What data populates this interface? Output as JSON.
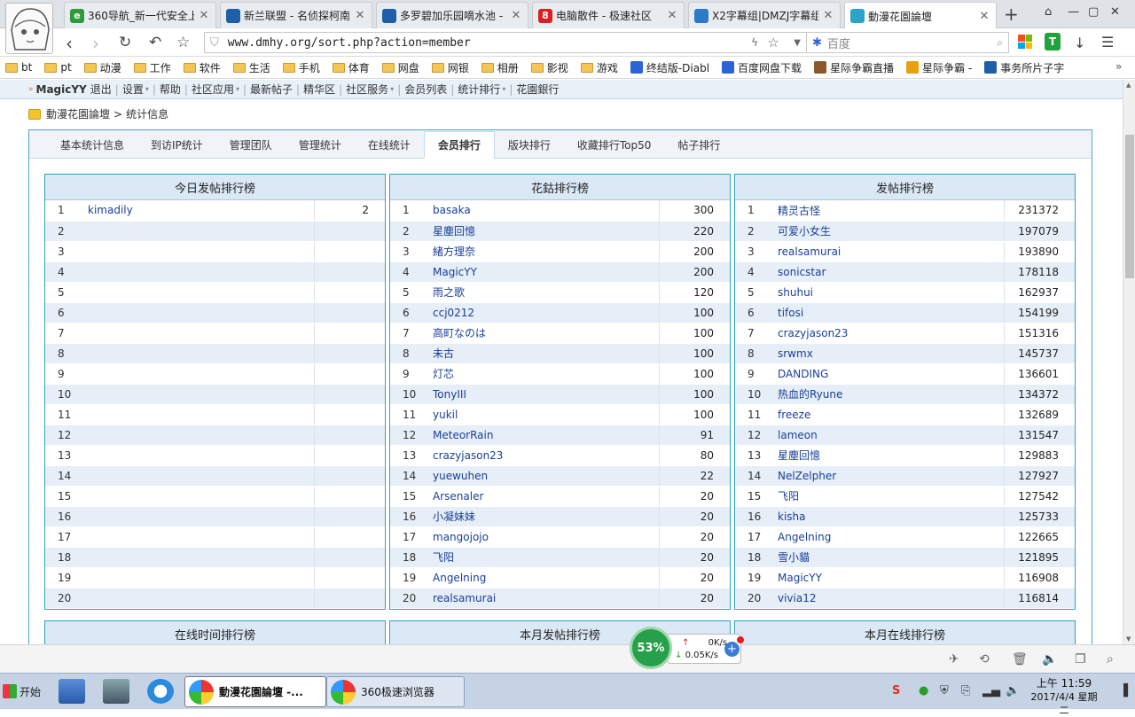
{
  "browser": {
    "tabs": [
      {
        "title": "360导航_新一代安全上",
        "icon_color": "#2e9a3a",
        "icon_glyph": "e"
      },
      {
        "title": "新兰联盟 - 名侦探柯南",
        "icon_color": "#1d5fa8",
        "icon_glyph": ""
      },
      {
        "title": "多罗碧加乐园嘀水池 -",
        "icon_color": "#1d5fa8",
        "icon_glyph": ""
      },
      {
        "title": "电脑散件 - 极速社区",
        "icon_color": "#d92020",
        "icon_glyph": "8"
      },
      {
        "title": "X2字幕组|DMZJ字幕组",
        "icon_color": "#2a7bc7",
        "icon_glyph": ""
      },
      {
        "title": "動漫花園論壇",
        "icon_color": "#2aa4c8",
        "icon_glyph": ""
      }
    ],
    "active_tab": 5,
    "url": "www.dmhy.org/sort.php?action=member",
    "search_placeholder": "百度",
    "bookmarks": [
      {
        "label": "bt",
        "type": "folder"
      },
      {
        "label": "pt",
        "type": "folder"
      },
      {
        "label": "动漫",
        "type": "folder"
      },
      {
        "label": "工作",
        "type": "folder"
      },
      {
        "label": "软件",
        "type": "folder"
      },
      {
        "label": "生活",
        "type": "folder"
      },
      {
        "label": "手机",
        "type": "folder"
      },
      {
        "label": "体育",
        "type": "folder"
      },
      {
        "label": "网盘",
        "type": "folder"
      },
      {
        "label": "网银",
        "type": "folder"
      },
      {
        "label": "相册",
        "type": "folder"
      },
      {
        "label": "影视",
        "type": "folder"
      },
      {
        "label": "游戏",
        "type": "folder"
      },
      {
        "label": "终结版-Diabl",
        "type": "link",
        "color": "#2c64d6"
      },
      {
        "label": "百度网盘下载",
        "type": "link",
        "color": "#2c64d6"
      },
      {
        "label": "星际争霸直播",
        "type": "link",
        "color": "#8a5a2b"
      },
      {
        "label": "星际争霸 -",
        "type": "link",
        "color": "#e8a010"
      },
      {
        "label": "事务所片子字",
        "type": "link",
        "color": "#1d5fa8"
      }
    ]
  },
  "site_nav": {
    "username": "MagicYY",
    "items": [
      "退出",
      "设置",
      "帮助",
      "社区应用",
      "最新帖子",
      "精华区",
      "社区服务",
      "会员列表",
      "统计排行",
      "花園銀行"
    ]
  },
  "breadcrumb": {
    "home": "動漫花園論壇",
    "current": "统计信息"
  },
  "subtabs": [
    "基本统计信息",
    "到访IP统计",
    "管理团队",
    "管理统计",
    "在线统计",
    "会员排行",
    "版块排行",
    "收藏排行Top50",
    "帖子排行"
  ],
  "active_subtab": 5,
  "rankings": [
    {
      "title": "今日发帖排行榜",
      "rows": [
        {
          "n": "1",
          "name": "kimadily",
          "value": "2"
        },
        {
          "n": "2",
          "name": "",
          "value": ""
        },
        {
          "n": "3",
          "name": "",
          "value": ""
        },
        {
          "n": "4",
          "name": "",
          "value": ""
        },
        {
          "n": "5",
          "name": "",
          "value": ""
        },
        {
          "n": "6",
          "name": "",
          "value": ""
        },
        {
          "n": "7",
          "name": "",
          "value": ""
        },
        {
          "n": "8",
          "name": "",
          "value": ""
        },
        {
          "n": "9",
          "name": "",
          "value": ""
        },
        {
          "n": "10",
          "name": "",
          "value": ""
        },
        {
          "n": "11",
          "name": "",
          "value": ""
        },
        {
          "n": "12",
          "name": "",
          "value": ""
        },
        {
          "n": "13",
          "name": "",
          "value": ""
        },
        {
          "n": "14",
          "name": "",
          "value": ""
        },
        {
          "n": "15",
          "name": "",
          "value": ""
        },
        {
          "n": "16",
          "name": "",
          "value": ""
        },
        {
          "n": "17",
          "name": "",
          "value": ""
        },
        {
          "n": "18",
          "name": "",
          "value": ""
        },
        {
          "n": "19",
          "name": "",
          "value": ""
        },
        {
          "n": "20",
          "name": "",
          "value": ""
        }
      ]
    },
    {
      "title": "花鈷排行榜",
      "rows": [
        {
          "n": "1",
          "name": "basaka",
          "value": "300"
        },
        {
          "n": "2",
          "name": "星塵回憶",
          "value": "220"
        },
        {
          "n": "3",
          "name": "緒方理奈",
          "value": "200"
        },
        {
          "n": "4",
          "name": "MagicYY",
          "value": "200"
        },
        {
          "n": "5",
          "name": "雨之歌",
          "value": "120"
        },
        {
          "n": "6",
          "name": "ccj0212",
          "value": "100"
        },
        {
          "n": "7",
          "name": "高町なのは",
          "value": "100"
        },
        {
          "n": "8",
          "name": "未古",
          "value": "100"
        },
        {
          "n": "9",
          "name": "灯芯",
          "value": "100"
        },
        {
          "n": "10",
          "name": "TonyIII",
          "value": "100"
        },
        {
          "n": "11",
          "name": "yukil",
          "value": "100"
        },
        {
          "n": "12",
          "name": "MeteorRain",
          "value": "91"
        },
        {
          "n": "13",
          "name": "crazyjason23",
          "value": "80"
        },
        {
          "n": "14",
          "name": "yuewuhen",
          "value": "22"
        },
        {
          "n": "15",
          "name": "Arsenaler",
          "value": "20"
        },
        {
          "n": "16",
          "name": "小凝妹妹",
          "value": "20"
        },
        {
          "n": "17",
          "name": "mangojojo",
          "value": "20"
        },
        {
          "n": "18",
          "name": "飞阳",
          "value": "20"
        },
        {
          "n": "19",
          "name": "Angelning",
          "value": "20"
        },
        {
          "n": "20",
          "name": "realsamurai",
          "value": "20"
        }
      ]
    },
    {
      "title": "发帖排行榜",
      "rows": [
        {
          "n": "1",
          "name": "精灵古怪",
          "value": "231372"
        },
        {
          "n": "2",
          "name": "可爱小女生",
          "value": "197079"
        },
        {
          "n": "3",
          "name": "realsamurai",
          "value": "193890"
        },
        {
          "n": "4",
          "name": "sonicstar",
          "value": "178118"
        },
        {
          "n": "5",
          "name": "shuhui",
          "value": "162937"
        },
        {
          "n": "6",
          "name": "tifosi",
          "value": "154199"
        },
        {
          "n": "7",
          "name": "crazyjason23",
          "value": "151316"
        },
        {
          "n": "8",
          "name": "srwmx",
          "value": "145737"
        },
        {
          "n": "9",
          "name": "DANDING",
          "value": "136601"
        },
        {
          "n": "10",
          "name": "热血的Ryune",
          "value": "134372"
        },
        {
          "n": "11",
          "name": "freeze",
          "value": "132689"
        },
        {
          "n": "12",
          "name": "lameon",
          "value": "131547"
        },
        {
          "n": "13",
          "name": "星塵回憶",
          "value": "129883"
        },
        {
          "n": "14",
          "name": "NelZelpher",
          "value": "127927"
        },
        {
          "n": "15",
          "name": "飞阳",
          "value": "127542"
        },
        {
          "n": "16",
          "name": "kisha",
          "value": "125733"
        },
        {
          "n": "17",
          "name": "Angelning",
          "value": "122665"
        },
        {
          "n": "18",
          "name": "雪小貓",
          "value": "121895"
        },
        {
          "n": "19",
          "name": "MagicYY",
          "value": "116908"
        },
        {
          "n": "20",
          "name": "vivia12",
          "value": "116814"
        }
      ]
    }
  ],
  "rankings_row2": [
    "在线时间排行榜",
    "本月发帖排行榜",
    "本月在线排行榜"
  ],
  "speed_widget": {
    "percent": "53%",
    "up": "0K/s",
    "down": "0.05K/s"
  },
  "taskbar": {
    "start": "开始",
    "tasks": [
      "動漫花園論壇 -...",
      "360极速浏览器"
    ],
    "time": "上午 11:59",
    "date": "2017/4/4 星期二"
  }
}
